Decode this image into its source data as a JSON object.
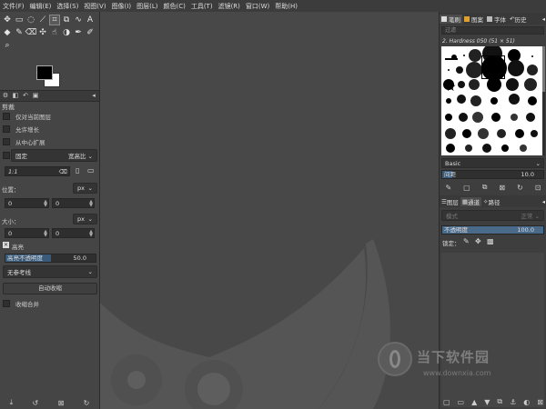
{
  "menubar": {
    "items": [
      "文件(F)",
      "编辑(E)",
      "选择(S)",
      "视图(V)",
      "图像(I)",
      "图层(L)",
      "颜色(C)",
      "工具(T)",
      "滤镜(R)",
      "窗口(W)",
      "帮助(H)"
    ]
  },
  "toolbox": {
    "tools": [
      "move-tool-icon",
      "rect-select-tool-icon",
      "lasso-tool-icon",
      "fuzzy-select-tool-icon",
      "crop-tool-icon",
      "unified-transform-tool-icon",
      "warp-tool-icon",
      "text-tool-icon",
      "fill-tool-icon",
      "paintbrush-tool-icon",
      "eraser-tool-icon",
      "clone-tool-icon",
      "smudge-tool-icon",
      "dodge-tool-icon",
      "path-tool-icon",
      "color-picker-tool-icon",
      "zoom-tool-icon"
    ],
    "active_tool": "crop-tool-icon"
  },
  "colors": {
    "foreground": "#000000",
    "background": "#ffffff"
  },
  "tool_options": {
    "title": "剪裁",
    "current_layer_only": "仅对当前图层",
    "allow_growing": "允许增长",
    "expand_from_center": "从中心扩展",
    "fixed_label": "固定",
    "fixed_mode": "宽高比",
    "ratio_value": "1:1",
    "position_label": "位置：",
    "position_unit": "px",
    "position_x": "0",
    "position_y": "0",
    "size_label": "大小：",
    "size_unit": "px",
    "size_w": "0",
    "size_h": "0",
    "highlight_label": "高亮",
    "highlight_opacity_label": "高亮不透明度",
    "highlight_opacity_value": "50.0",
    "guides": "无参考线",
    "auto_shrink": "自动收缩",
    "shrink_merged": "收缩合并"
  },
  "right_dock": {
    "tabs": [
      "笔刷",
      "图案",
      "字体",
      "历史"
    ],
    "filter_placeholder": "过滤",
    "brush_name": "2. Hardness 050 (51 × 51)",
    "preset": "Basic",
    "spacing_label": "间距",
    "spacing_value": "10.0",
    "layer_tabs": [
      "图层",
      "通道",
      "路径"
    ],
    "mode_label": "模式",
    "mode_value": "正常",
    "opacity_label": "不透明度",
    "opacity_value": "100.0",
    "lock_label": "锁定："
  },
  "watermark": {
    "brand": "当下软件园",
    "url": "www.downxia.com"
  }
}
